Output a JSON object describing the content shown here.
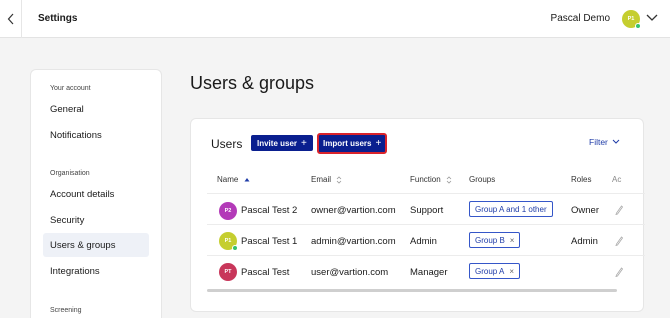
{
  "header": {
    "title": "Settings",
    "user_name": "Pascal Demo",
    "user_initials": "P1"
  },
  "sidebar": {
    "sections": [
      {
        "label": "Your account",
        "items": [
          "General",
          "Notifications"
        ]
      },
      {
        "label": "Organisation",
        "items": [
          "Account details",
          "Security",
          "Users & groups",
          "Integrations"
        ]
      },
      {
        "label": "Screening",
        "items": []
      }
    ],
    "active_item": "Users & groups"
  },
  "page": {
    "title": "Users & groups"
  },
  "users_card": {
    "title": "Users",
    "invite_label": "Invite user",
    "import_label": "Import users",
    "filter_label": "Filter",
    "columns": [
      "Name",
      "Email",
      "Function",
      "Groups",
      "Roles",
      "Ac"
    ],
    "rows": [
      {
        "initials": "P2",
        "avatar_color": "#b33ab8",
        "online": false,
        "name": "Pascal Test 2",
        "email": "owner@vartion.com",
        "function": "Support",
        "group": "Group A and 1 other",
        "group_removable": false,
        "role": "Owner"
      },
      {
        "initials": "P1",
        "avatar_color": "#c5ce2f",
        "online": true,
        "name": "Pascal Test 1",
        "email": "admin@vartion.com",
        "function": "Admin",
        "group": "Group B",
        "group_removable": true,
        "role": "Admin"
      },
      {
        "initials": "PT",
        "avatar_color": "#c8365a",
        "online": false,
        "name": "Pascal Test",
        "email": "user@vartion.com",
        "function": "Manager",
        "group": "Group A",
        "group_removable": true,
        "role": ""
      }
    ]
  },
  "colors": {
    "primary": "#0a1f8f",
    "link": "#1f3ca8",
    "highlight": "#d9232b",
    "online": "#37c26b"
  }
}
